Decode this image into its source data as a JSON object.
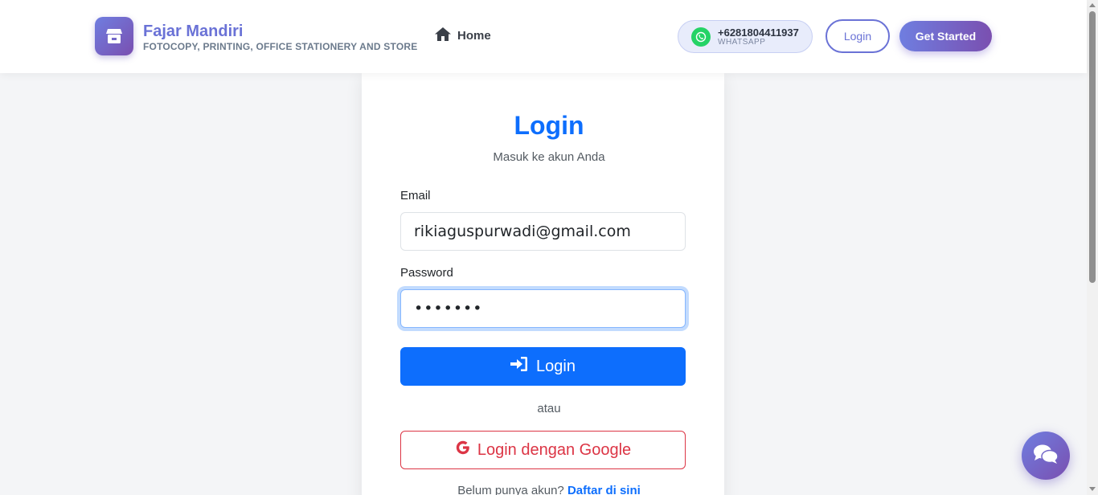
{
  "navbar": {
    "brand_name": "Fajar Mandiri",
    "brand_tagline": "FOTOCOPY, PRINTING, OFFICE STATIONERY AND STORE",
    "brand_icon": "store-icon",
    "home_label": "Home",
    "home_icon": "home-icon",
    "whatsapp_number": "+6281804411937",
    "whatsapp_label": "WHATSAPP",
    "whatsapp_icon": "whatsapp-icon",
    "login_label": "Login",
    "get_started_label": "Get Started"
  },
  "login_form": {
    "title": "Login",
    "subtitle": "Masuk ke akun Anda",
    "email_label": "Email",
    "email_value": "rikiaguspurwadi@gmail.com",
    "password_label": "Password",
    "password_value": "•••••••",
    "submit_label": "Login",
    "submit_icon": "sign-in-icon",
    "divider_text": "atau",
    "google_label": "Login dengan Google",
    "google_icon": "google-icon",
    "register_prompt": "Belum punya akun?",
    "register_link": "Daftar di sini"
  },
  "chat": {
    "icon": "chat-bubbles-icon"
  },
  "colors": {
    "primary": "#0d6efd",
    "brand_gradient_start": "#6f7ee0",
    "brand_gradient_end": "#7a4fb0",
    "google_red": "#dc3545",
    "whatsapp_green": "#25d366"
  }
}
